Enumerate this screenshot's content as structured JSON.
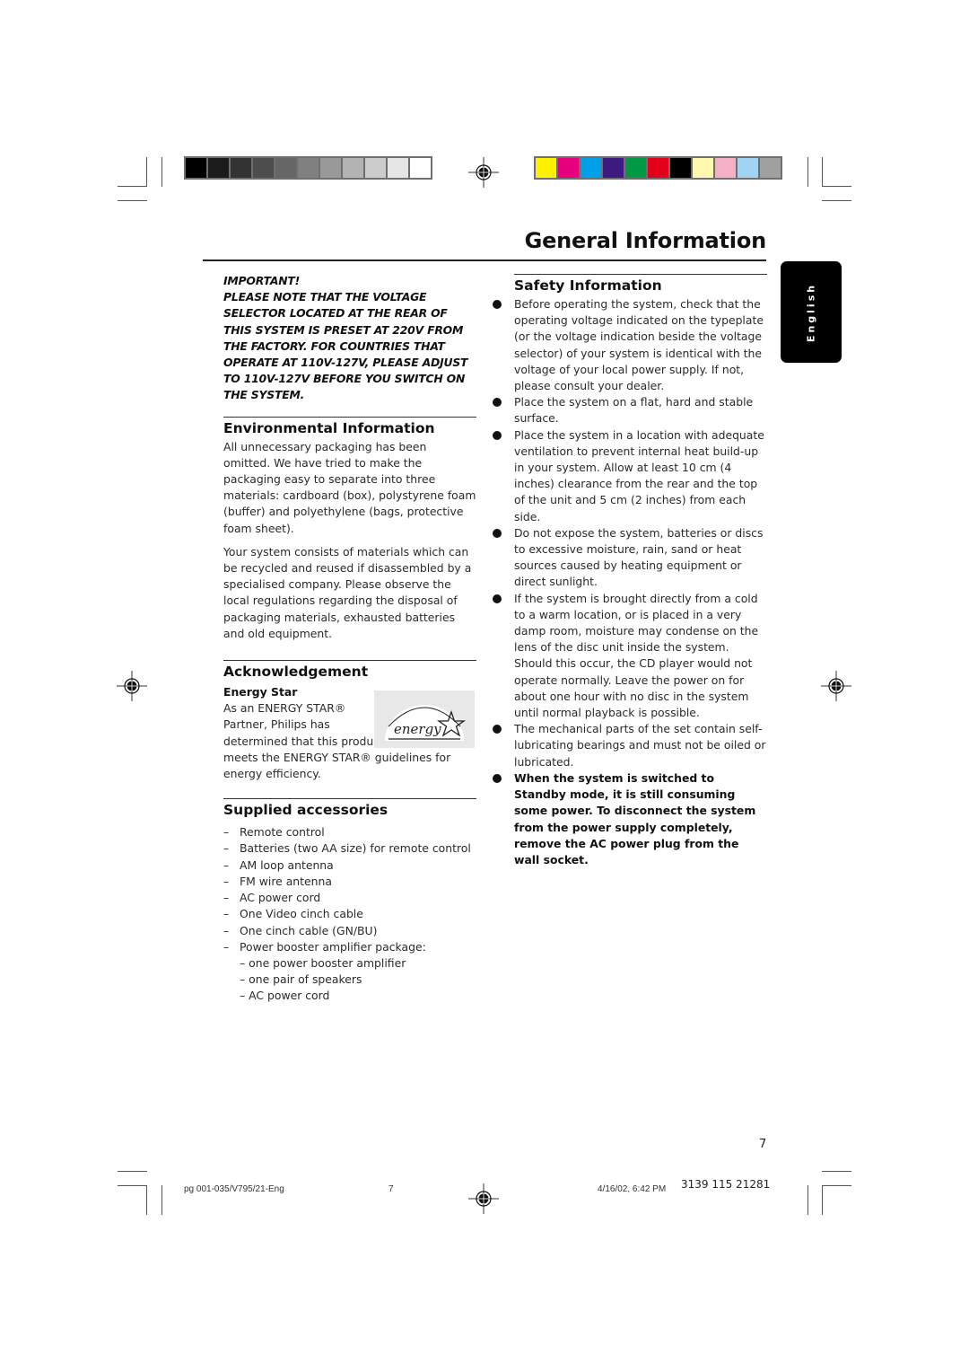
{
  "print_marks": {
    "gray_swatches": [
      "#000000",
      "#1b1b1b",
      "#333333",
      "#4d4d4d",
      "#666666",
      "#808080",
      "#999999",
      "#b3b3b3",
      "#cccccc",
      "#e6e6e6",
      "#ffffff"
    ],
    "color_swatches": [
      "#fff200",
      "#e6007e",
      "#00a0e9",
      "#3c1a80",
      "#009a44",
      "#e2001a",
      "#000000",
      "#fff9b0",
      "#f5b0c8",
      "#a0d4f2",
      "#a0a0a0"
    ]
  },
  "header": {
    "title": "General Information"
  },
  "language_tab": {
    "label": "English"
  },
  "important_notice": {
    "heading": "IMPORTANT!",
    "lines": [
      "PLEASE NOTE THAT THE VOLTAGE",
      "SELECTOR LOCATED AT THE REAR OF",
      "THIS SYSTEM IS PRESET AT 220V FROM",
      "THE FACTORY. FOR COUNTRIES THAT",
      "OPERATE AT 110V-127V, PLEASE ADJUST",
      "TO 110V-127V BEFORE YOU SWITCH ON",
      "THE SYSTEM."
    ]
  },
  "environmental": {
    "title": "Environmental Information",
    "paragraphs": [
      "All unnecessary packaging has been omitted. We have tried to make the packaging easy to separate into three materials: cardboard (box), polystyrene foam (buffer) and polyethylene (bags, protective foam sheet).",
      "Your system consists of materials which can be recycled and reused if disassembled by a specialised company. Please observe the local regulations regarding the disposal of packaging materials, exhausted batteries and old equipment."
    ]
  },
  "acknowledgement": {
    "title": "Acknowledgement",
    "subtitle": "Energy Star",
    "text_lines": [
      "As an ENERGY STAR®",
      "Partner, Philips has",
      "determined that this product"
    ],
    "text_rest": "meets the ENERGY STAR® guidelines for energy efficiency.",
    "logo_label": "energy"
  },
  "accessories": {
    "title": "Supplied accessories",
    "items": [
      "Remote control",
      "Batteries (two AA size) for remote control",
      "AM loop antenna",
      "FM wire antenna",
      "AC power cord",
      "One Video cinch cable",
      "One cinch cable (GN/BU)",
      "Power booster amplifier package:"
    ],
    "sub_items": [
      "one power booster amplifier",
      "one pair of speakers",
      "AC power cord"
    ],
    "dash": "–"
  },
  "safety": {
    "title": "Safety Information",
    "items": [
      "Before operating the system, check that the operating voltage indicated on the typeplate (or the voltage indication beside the voltage selector) of your system is identical with the voltage of your local power supply. If not, please consult your dealer.",
      "Place the system on a flat, hard and stable surface.",
      "Place the system in a location with adequate ventilation to prevent internal heat build-up in your system.  Allow at least 10 cm (4 inches) clearance from the rear and the top of the unit and 5 cm (2 inches) from each side.",
      "Do not expose the system, batteries or discs to excessive moisture, rain, sand or heat sources caused by heating equipment or direct sunlight.",
      "If the system is brought directly from a cold to a warm location, or is placed in a very damp room, moisture may condense on the lens of the disc unit inside the system. Should this occur, the CD player would not operate normally. Leave the power on for about one hour with no disc in the system until normal playback is possible.",
      "The mechanical parts of the set contain self-lubricating bearings and must not be oiled or lubricated."
    ],
    "bold_item": "When the system is switched to Standby mode, it is still consuming some power. To disconnect the system from the power supply completely, remove the AC power plug from the wall socket."
  },
  "page_number": "7",
  "footer": {
    "file": "pg 001-035/V795/21-Eng",
    "page": "7",
    "date": "4/16/02, 6:42 PM",
    "code": "3139 115 21281"
  }
}
